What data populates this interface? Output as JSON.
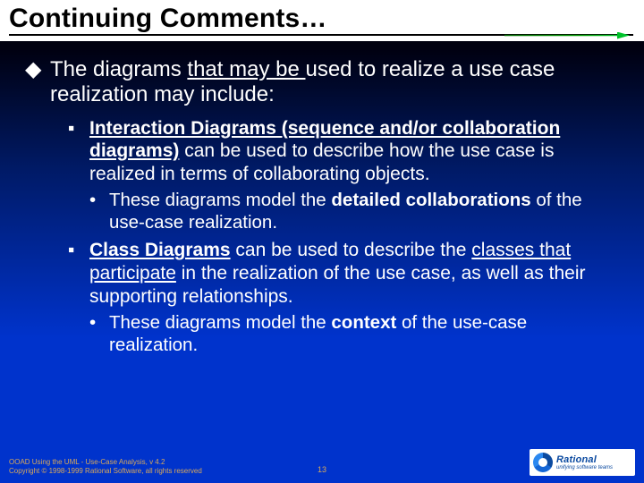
{
  "title": "Continuing Comments…",
  "lvl1_pre": "The diagrams ",
  "lvl1_u": "that may be ",
  "lvl1_post": "used to realize a use case realization may include:",
  "i1_b": "Interaction Diagrams (sequence and/or collaboration diagrams)",
  "i1_rest": " can be used to describe how the use case is realized in terms of collaborating objects.",
  "i1_sub_pre": "These diagrams model the ",
  "i1_sub_b": "detailed collaborations",
  "i1_sub_post": " of the use-case realization.",
  "i2_b": "Class Diagrams",
  "i2_mid": " can be used to describe the ",
  "i2_u": "classes that participate",
  "i2_post": " in the realization of the use case, as well as their supporting relationships.",
  "i2_sub_pre": "These diagrams model the ",
  "i2_sub_b": "context",
  "i2_sub_post": " of the use-case realization.",
  "footer1": "OOAD Using the UML - Use-Case Analysis, v 4.2",
  "footer2": "Copyright © 1998-1999 Rational Software, all rights reserved",
  "page": "13",
  "logo_main": "Rational",
  "logo_sub": "unifying software teams"
}
